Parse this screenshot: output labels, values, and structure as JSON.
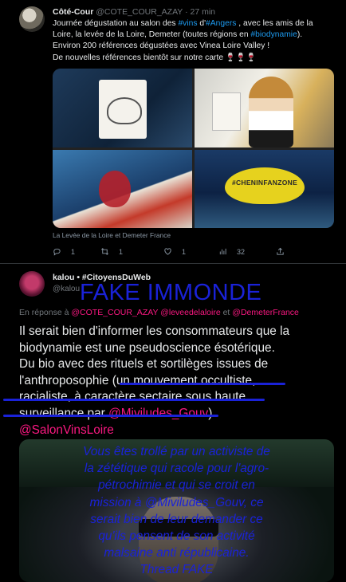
{
  "tweet1": {
    "author": "Côté-Cour",
    "handle": "@COTE_COUR_AZAY",
    "time": "· 27 min",
    "lines": [
      [
        {
          "t": "Journée dégustation au salon des "
        },
        {
          "t": "#vins",
          "c": "blue"
        },
        {
          "t": " d'"
        },
        {
          "t": "#Angers",
          "c": "blue"
        },
        {
          "t": " , avec les amis de la"
        }
      ],
      [
        {
          "t": "Loire, la levée de la Loire, Demeter (toutes régions en "
        },
        {
          "t": "#biodynamie",
          "c": "blue"
        },
        {
          "t": ")."
        }
      ],
      [
        {
          "t": "Environ 200 références dégustées avec Vinea Loire Valley !"
        }
      ],
      [
        {
          "t": "De nouvelles références bientôt sur notre carte 🍷🍷🍷"
        }
      ]
    ],
    "lamp_text": "#CHENINFANZONE",
    "caption": "La Levée de la Loire et Demeter France",
    "replies": "1",
    "retweets": "1",
    "likes": "1",
    "views": "32"
  },
  "tweet2": {
    "name": "kalou • #CitoyensDuWeb",
    "handle": "@kalou",
    "stamp": "FAKE IMMONDE",
    "reply_prefix": "En réponse à",
    "reply_to_1": "@COTE_COUR_AZAY",
    "reply_to_2": "@leveedelaloire",
    "reply_and": "et",
    "reply_to_3": "@DemeterFrance",
    "body_lines": [
      [
        {
          "t": "Il serait bien d'informer les consommateurs que la"
        }
      ],
      [
        {
          "t": "biodynamie est une pseudoscience ésotérique."
        }
      ],
      [
        {
          "t": "Du bio avec des rituels et sortilèges issues de"
        }
      ],
      [
        {
          "t": "l'anthroposophie (un mouvement occultiste,"
        }
      ],
      [
        {
          "t": "racialiste, à caractère sectaire sous haute"
        }
      ],
      [
        {
          "t": "surveillance par "
        },
        {
          "t": "@Miviludes_Gouv",
          "c": "pink"
        },
        {
          "t": ")"
        }
      ],
      [
        {
          "t": "@SalonVinsLoire",
          "c": "pink"
        }
      ]
    ],
    "overlay_lines": [
      "Vous êtes trollé par un activiste de",
      "la zététique qui racole pour l'agro-",
      "pétrochimie et qui se croit en",
      "mission à @Miviludes_Gouv, ce",
      "serait bien de leur demander ce",
      "qu'ils pensent de son activité",
      "malsaine anti républicaine.",
      "Thread FAKE"
    ]
  },
  "colors": {
    "link": "#1d9bf0",
    "mention": "#f91880",
    "annotation": "#1a22d8",
    "background": "#000000"
  },
  "icons": [
    "reply-icon",
    "retweet-icon",
    "like-icon",
    "views-icon",
    "share-icon"
  ]
}
